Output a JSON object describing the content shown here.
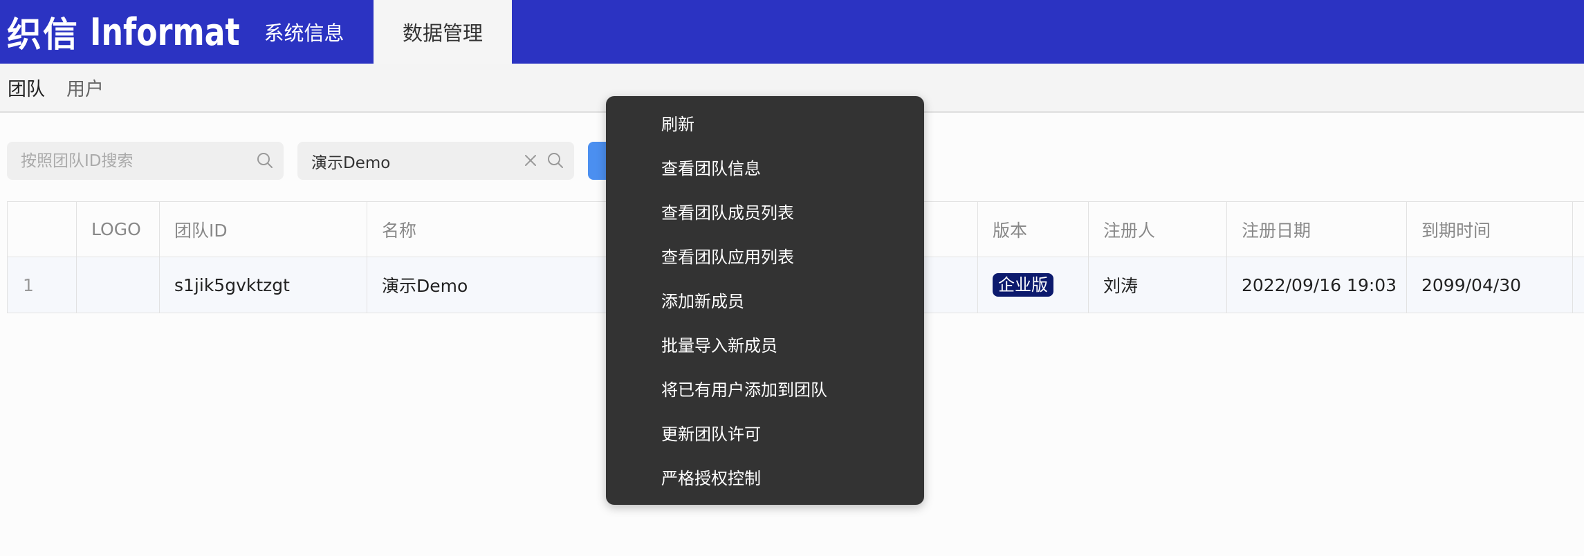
{
  "header": {
    "logo_cn": "织信",
    "logo_en": "Informat",
    "tabs": [
      {
        "label": "系统信息"
      },
      {
        "label": "数据管理"
      }
    ]
  },
  "subnav": {
    "tabs": [
      {
        "label": "团队"
      },
      {
        "label": "用户"
      }
    ]
  },
  "search": {
    "id_placeholder": "按照团队ID搜索",
    "name_value": "演示Demo"
  },
  "table": {
    "headers": [
      "",
      "LOGO",
      "团队ID",
      "名称",
      "",
      "版本",
      "注册人",
      "注册日期",
      "到期时间"
    ],
    "rows": [
      {
        "index": "1",
        "logo": "",
        "team_id": "s1jik5gvktzgt",
        "name": "演示Demo",
        "edition": "企业版",
        "registrant": "刘涛",
        "register_date": "2022/09/16 19:03",
        "expire_date": "2099/04/30"
      }
    ]
  },
  "context_menu": {
    "items": [
      {
        "label": "刷新"
      },
      {
        "label": "查看团队信息"
      },
      {
        "label": "查看团队成员列表"
      },
      {
        "label": "查看团队应用列表"
      },
      {
        "label": "添加新成员"
      },
      {
        "label": "批量导入新成员"
      },
      {
        "label": "将已有用户添加到团队"
      },
      {
        "label": "更新团队许可"
      },
      {
        "label": "严格授权控制"
      }
    ]
  },
  "colors": {
    "header_bg": "#2b33c2",
    "menu_bg": "#333333",
    "badge_bg": "#0c1a6d",
    "primary_button": "#4b8ff0"
  }
}
